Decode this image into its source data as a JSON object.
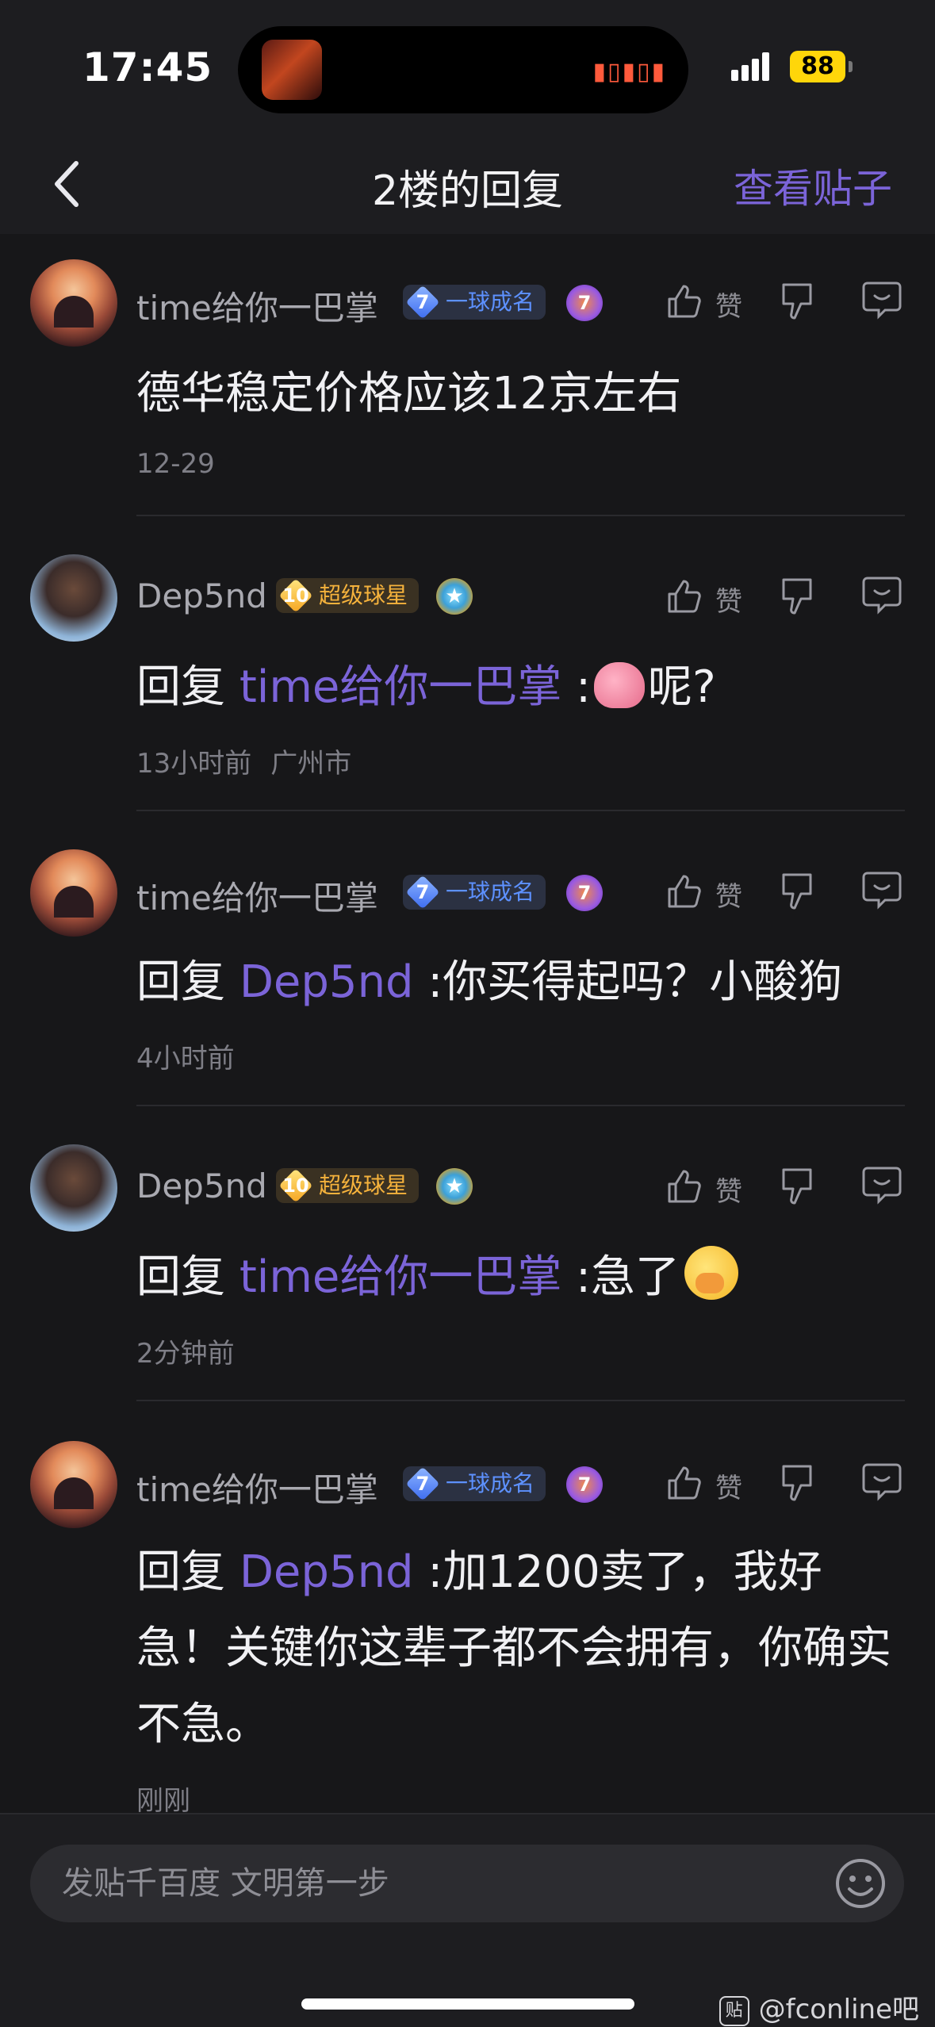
{
  "status": {
    "time": "17:45",
    "battery": "88"
  },
  "nav": {
    "title": "2楼的回复",
    "right_link": "查看贴子"
  },
  "like_label": "赞",
  "replies": [
    {
      "username": "time给你一巴掌",
      "level": "7",
      "badge": "一球成名",
      "medal": "7",
      "content_text": "德华稳定价格应该12京左右",
      "time": "12-29"
    },
    {
      "username": "Dep5nd",
      "level": "10",
      "badge": "超级球星",
      "prefix": "回复",
      "mention": "time给你一巴掌",
      "after_mention": " :",
      "tail": "呢?",
      "time": "13小时前",
      "location": "广州市"
    },
    {
      "username": "time给你一巴掌",
      "level": "7",
      "badge": "一球成名",
      "medal": "7",
      "prefix": "回复",
      "mention": "Dep5nd",
      "tail": " :你买得起吗？小酸狗",
      "time": "4小时前"
    },
    {
      "username": "Dep5nd",
      "level": "10",
      "badge": "超级球星",
      "prefix": "回复",
      "mention": "time给你一巴掌",
      "tail": " :急了",
      "time": "2分钟前"
    },
    {
      "username": "time给你一巴掌",
      "level": "7",
      "badge": "一球成名",
      "medal": "7",
      "prefix": "回复",
      "mention": "Dep5nd",
      "tail": " :加1200卖了，我好急！关键你这辈子都不会拥有，你确实不急。",
      "time": "刚刚"
    }
  ],
  "composer": {
    "placeholder": "发贴千百度 文明第一步"
  },
  "watermark": {
    "icon": "贴",
    "text": "@fconline吧"
  },
  "colors": {
    "accent": "#7b64d8",
    "background": "#171719",
    "bar": "#1d1d20"
  },
  "icons": [
    "back-chevron-icon",
    "like-thumb-icon",
    "dislike-thumb-icon",
    "comment-bubble-icon",
    "emoji-smile-icon",
    "brain-emoji",
    "hand-over-mouth-emoji"
  ]
}
